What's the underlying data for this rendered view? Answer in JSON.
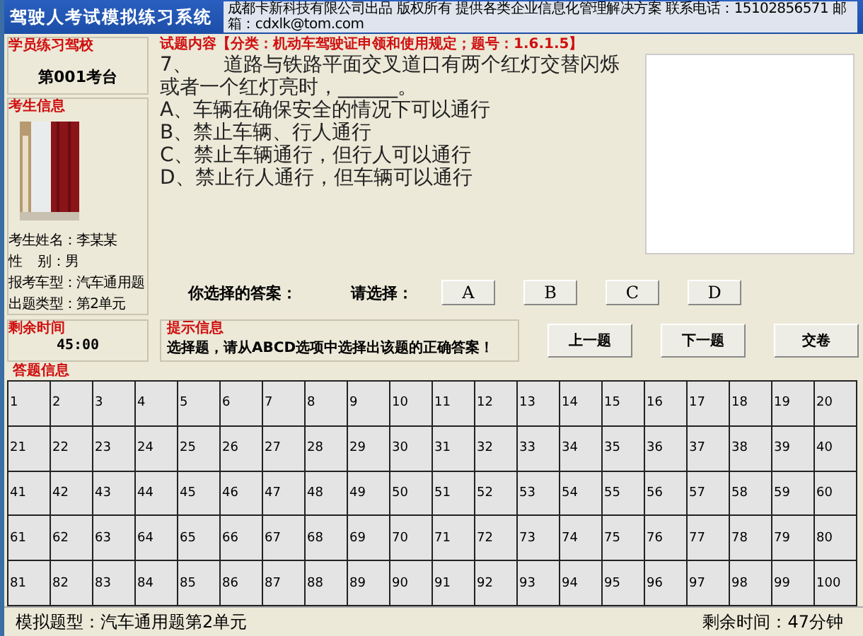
{
  "window": {
    "title": "驾驶人考试模拟练习系统",
    "info": "成都卡新科技有限公司出品 版权所有  提供各类企业信息化管理解决方案 联系电话：15102856571 邮箱：cdxlk@tom.com"
  },
  "school": {
    "heading": "学员练习驾校",
    "station": "第001考台"
  },
  "candidate": {
    "heading": "考生信息",
    "fields": [
      {
        "label": "考生姓名：",
        "value": "李某某"
      },
      {
        "label": "性    别：",
        "value": "男"
      },
      {
        "label": "报考车型：",
        "value": "汽车通用题"
      },
      {
        "label": "出题类型：",
        "value": "第2单元"
      }
    ]
  },
  "question": {
    "heading": "试题内容【分类：机动车驾驶证申领和使用规定；题号：1.6.1.5】",
    "lines": [
      "7、     道路与铁路平面交叉道口有两个红灯交替闪烁",
      "或者一个红灯亮时，______。",
      "A、车辆在确保安全的情况下可以通行",
      "B、禁止车辆、行人通行",
      "C、禁止车辆通行，但行人可以通行",
      "D、禁止行人通行，但车辆可以通行"
    ]
  },
  "answer": {
    "your_answer_label": "你选择的答案：",
    "choose_label": "请选择：",
    "options": [
      "A",
      "B",
      "C",
      "D"
    ]
  },
  "timer": {
    "heading": "剩余时间",
    "value": "45:00"
  },
  "hint": {
    "heading": "提示信息",
    "text": "选择题，请从ABCD选项中选择出该题的正确答案！"
  },
  "nav_buttons": [
    "上一题",
    "下一题",
    "交卷"
  ],
  "answer_grid": {
    "heading": "答题信息",
    "cells": [
      "1",
      "2",
      "3",
      "4",
      "5",
      "6",
      "7",
      "8",
      "9",
      "10",
      "11",
      "12",
      "13",
      "14",
      "15",
      "16",
      "17",
      "18",
      "19",
      "20",
      "21",
      "22",
      "23",
      "24",
      "25",
      "26",
      "27",
      "28",
      "29",
      "30",
      "31",
      "32",
      "33",
      "34",
      "35",
      "36",
      "37",
      "38",
      "39",
      "40",
      "41",
      "42",
      "43",
      "44",
      "45",
      "46",
      "47",
      "48",
      "49",
      "50",
      "51",
      "52",
      "53",
      "54",
      "55",
      "56",
      "57",
      "58",
      "59",
      "60",
      "61",
      "62",
      "63",
      "64",
      "65",
      "66",
      "67",
      "68",
      "69",
      "70",
      "71",
      "72",
      "73",
      "74",
      "75",
      "76",
      "77",
      "78",
      "79",
      "80",
      "81",
      "82",
      "83",
      "84",
      "85",
      "86",
      "87",
      "88",
      "89",
      "90",
      "91",
      "92",
      "93",
      "94",
      "95",
      "96",
      "97",
      "98",
      "99",
      "100"
    ]
  },
  "status_bar": {
    "mode": "模拟题型：汽车通用题第2单元",
    "remaining": "剩余时间：47分钟"
  }
}
